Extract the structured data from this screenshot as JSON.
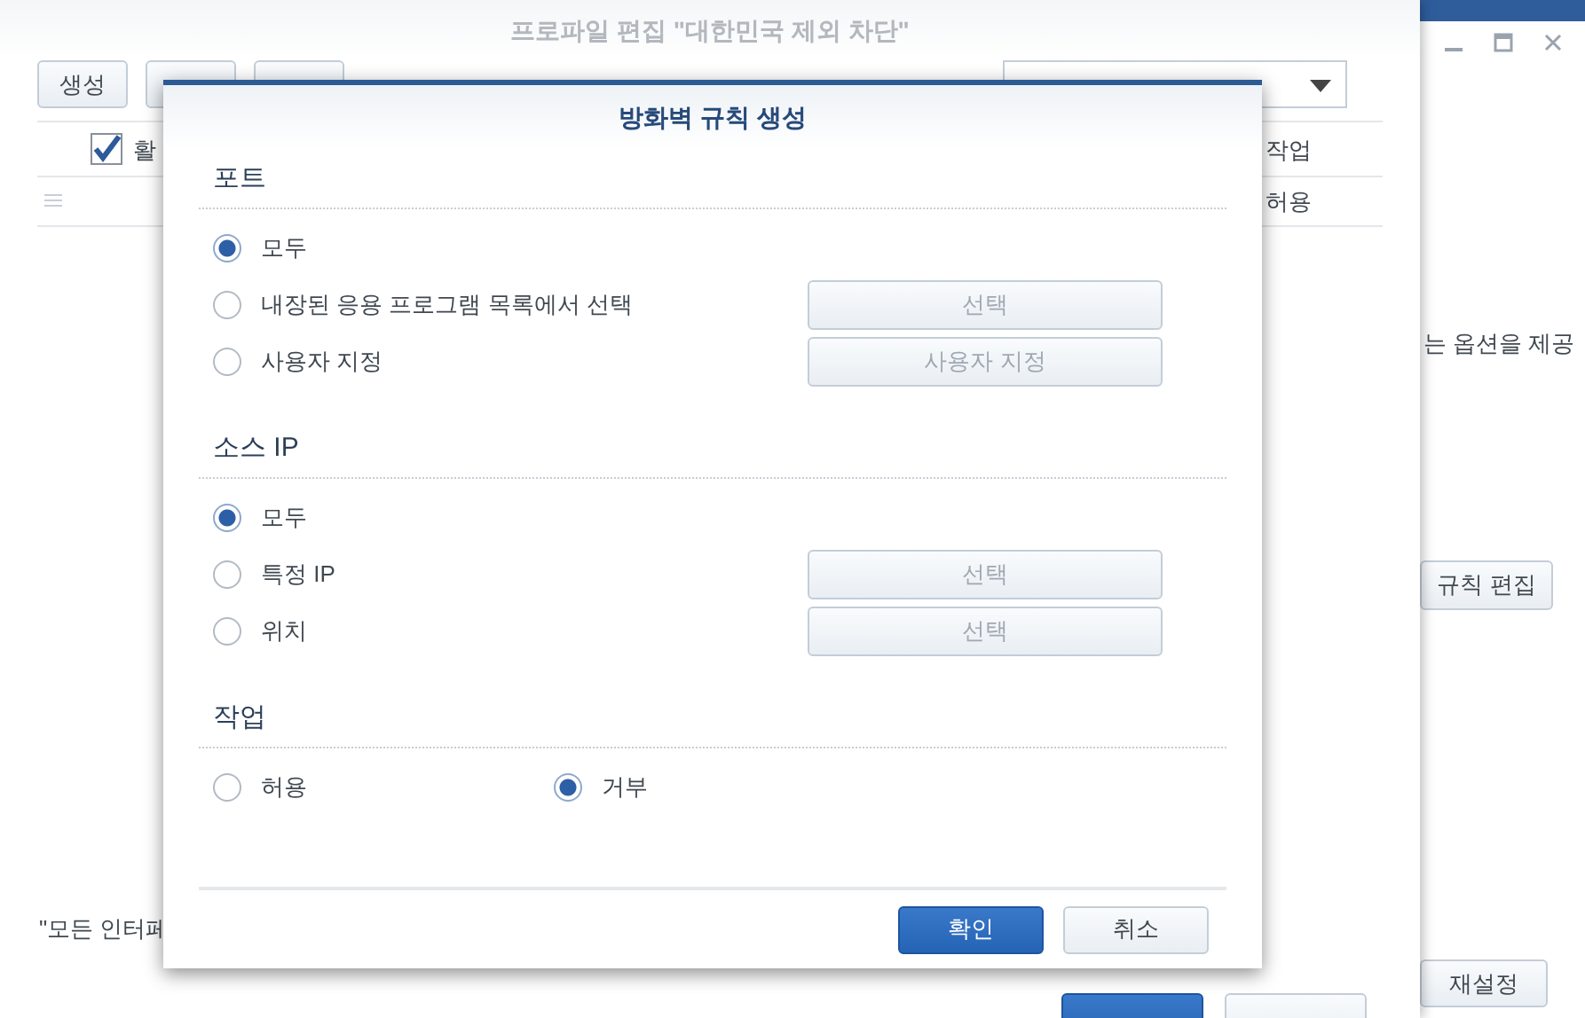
{
  "back_window": {
    "note_text": "는 옵션을 제공",
    "buttons": [
      "규칙 편집",
      "재설정"
    ]
  },
  "profile_window": {
    "title": "프로파일 편집 \"대한민국 제외 차단\"",
    "toolbar_buttons": [
      "생성"
    ],
    "table": {
      "select_all_checked": true,
      "first_header": "활",
      "action_header": "작업",
      "rows": [
        {
          "action": "허용"
        }
      ]
    },
    "footer_note": "\"모든 인터페"
  },
  "dialog": {
    "title": "방화벽 규칙 생성",
    "sections": [
      {
        "title": "포트",
        "kind": "stacked",
        "options": [
          {
            "label": "모두",
            "selected": true
          },
          {
            "label": "내장된 응용 프로그램 목록에서 선택",
            "selected": false,
            "button": {
              "label": "선택",
              "disabled": true
            }
          },
          {
            "label": "사용자 지정",
            "selected": false,
            "button": {
              "label": "사용자 지정",
              "disabled": true
            }
          }
        ]
      },
      {
        "title": "소스 IP",
        "kind": "stacked",
        "options": [
          {
            "label": "모두",
            "selected": true
          },
          {
            "label": "특정 IP",
            "selected": false,
            "button": {
              "label": "선택",
              "disabled": true
            }
          },
          {
            "label": "위치",
            "selected": false,
            "button": {
              "label": "선택",
              "disabled": true
            }
          }
        ]
      },
      {
        "title": "작업",
        "kind": "inline",
        "options": [
          {
            "label": "허용",
            "selected": false
          },
          {
            "label": "거부",
            "selected": true
          }
        ]
      }
    ],
    "buttons": [
      {
        "label": "확인",
        "kind": "primary"
      },
      {
        "label": "취소",
        "kind": "secondary"
      }
    ]
  }
}
